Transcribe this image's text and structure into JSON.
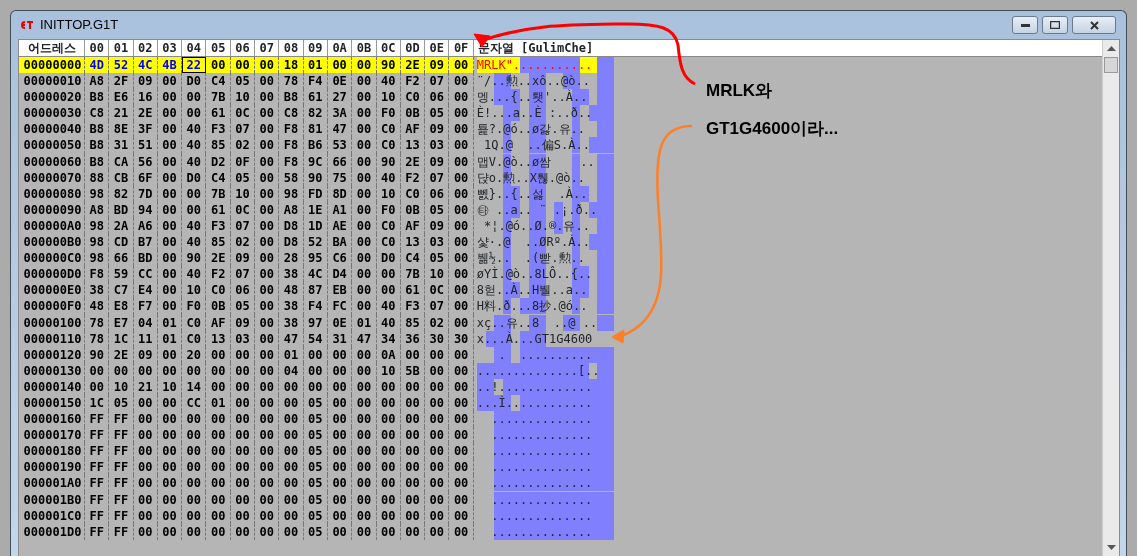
{
  "window": {
    "title": "INITTOP.G1T"
  },
  "header": {
    "address": "어드레스",
    "columns": [
      "00",
      "01",
      "02",
      "03",
      "04",
      "05",
      "06",
      "07",
      "08",
      "09",
      "0A",
      "0B",
      "0C",
      "0D",
      "0E",
      "0F"
    ],
    "text": "문자열 [GulimChe]"
  },
  "rows": [
    {
      "address": "00000000",
      "selected": true,
      "bytes": [
        {
          "v": "4D",
          "found": true
        },
        {
          "v": "52",
          "found": true
        },
        {
          "v": "4C",
          "found": true
        },
        {
          "v": "4B",
          "found": true
        },
        {
          "v": "22",
          "found": true,
          "cursor": true
        },
        "00",
        "00",
        "00",
        "18",
        "01",
        "00",
        "00",
        "90",
        "2E",
        "09",
        "00"
      ],
      "text": "MRLK\"..........."
    },
    {
      "address": "00000010",
      "selected": false,
      "bytes": [
        "A8",
        "2F",
        "09",
        "00",
        "D0",
        "C4",
        "05",
        "00",
        "78",
        "F4",
        "0E",
        "00",
        "40",
        "F2",
        "07",
        "00"
      ],
      "text": "¨/..勲..xô..@ò.."
    },
    {
      "address": "00000020",
      "selected": false,
      "bytes": [
        "B8",
        "E6",
        "16",
        "00",
        "00",
        "7B",
        "10",
        "00",
        "B8",
        "61",
        "27",
        "00",
        "10",
        "C0",
        "06",
        "00"
      ],
      "text": "멩...{..퇫'..À.."
    },
    {
      "address": "00000030",
      "selected": false,
      "bytes": [
        "C8",
        "21",
        "2E",
        "00",
        "00",
        "61",
        "0C",
        "00",
        "C8",
        "82",
        "3A",
        "00",
        "F0",
        "0B",
        "05",
        "00"
      ],
      "text": "È!...a..È :..ð.."
    },
    {
      "address": "00000040",
      "selected": false,
      "bytes": [
        "B8",
        "8E",
        "3F",
        "00",
        "40",
        "F3",
        "07",
        "00",
        "F8",
        "81",
        "47",
        "00",
        "C0",
        "AF",
        "09",
        "00"
      ],
      "text": "툝?.@ó..ø갏.유.."
    },
    {
      "address": "00000050",
      "selected": false,
      "bytes": [
        "B8",
        "31",
        "51",
        "00",
        "40",
        "85",
        "02",
        "00",
        "F8",
        "B6",
        "53",
        "00",
        "C0",
        "13",
        "03",
        "00"
      ],
      "text": " 1Q.@  ..偏S.À.."
    },
    {
      "address": "00000060",
      "selected": false,
      "bytes": [
        "B8",
        "CA",
        "56",
        "00",
        "40",
        "D2",
        "0F",
        "00",
        "F8",
        "9C",
        "66",
        "00",
        "90",
        "2E",
        "09",
        "00"
      ],
      "text": "맵V.@ò..ø쌈    .."
    },
    {
      "address": "00000070",
      "selected": false,
      "bytes": [
        "88",
        "CB",
        "6F",
        "00",
        "D0",
        "C4",
        "05",
        "00",
        "58",
        "90",
        "75",
        "00",
        "40",
        "F2",
        "07",
        "00"
      ],
      "text": "댡o.勲..X퉪.@ò.."
    },
    {
      "address": "00000080",
      "selected": false,
      "bytes": [
        "98",
        "82",
        "7D",
        "00",
        "00",
        "7B",
        "10",
        "00",
        "98",
        "FD",
        "8D",
        "00",
        "10",
        "C0",
        "06",
        "00"
      ],
      "text": "뻸}..{..섫  .À.."
    },
    {
      "address": "00000090",
      "selected": false,
      "bytes": [
        "A8",
        "BD",
        "94",
        "00",
        "00",
        "61",
        "0C",
        "00",
        "A8",
        "1E",
        "A1",
        "00",
        "F0",
        "0B",
        "05",
        "00"
      ],
      "text": "㉹ ..a.. ¨ .¡.ð.."
    },
    {
      "address": "000000A0",
      "selected": false,
      "bytes": [
        "98",
        "2A",
        "A6",
        "00",
        "40",
        "F3",
        "07",
        "00",
        "D8",
        "1D",
        "AE",
        "00",
        "C0",
        "AF",
        "09",
        "00"
      ],
      "text": " *¦.@ó..Ø.®.유.."
    },
    {
      "address": "000000B0",
      "selected": false,
      "bytes": [
        "98",
        "CD",
        "B7",
        "00",
        "40",
        "85",
        "02",
        "00",
        "D8",
        "52",
        "BA",
        "00",
        "C0",
        "13",
        "03",
        "00"
      ],
      "text": "샻·.@  ..ØRº.À.."
    },
    {
      "address": "000000C0",
      "selected": false,
      "bytes": [
        "98",
        "66",
        "BD",
        "00",
        "90",
        "2E",
        "09",
        "00",
        "28",
        "95",
        "C6",
        "00",
        "D0",
        "C4",
        "05",
        "00"
      ],
      "text": "뷂½..  .(빧.勲.."
    },
    {
      "address": "000000D0",
      "selected": false,
      "bytes": [
        "F8",
        "59",
        "CC",
        "00",
        "40",
        "F2",
        "07",
        "00",
        "38",
        "4C",
        "D4",
        "00",
        "00",
        "7B",
        "10",
        "00"
      ],
      "text": "øYÌ.@ò..8LÔ..{.."
    },
    {
      "address": "000000E0",
      "selected": false,
      "bytes": [
        "38",
        "C7",
        "E4",
        "00",
        "10",
        "C0",
        "06",
        "00",
        "48",
        "87",
        "EB",
        "00",
        "00",
        "61",
        "0C",
        "00"
      ],
      "text": "8헏..À..H뷀..a.."
    },
    {
      "address": "000000F0",
      "selected": false,
      "bytes": [
        "48",
        "E8",
        "F7",
        "00",
        "F0",
        "0B",
        "05",
        "00",
        "38",
        "F4",
        "FC",
        "00",
        "40",
        "F3",
        "07",
        "00"
      ],
      "text": "H料.ð...8抄.@ó.."
    },
    {
      "address": "00000100",
      "selected": false,
      "bytes": [
        "78",
        "E7",
        "04",
        "01",
        "C0",
        "AF",
        "09",
        "00",
        "38",
        "97",
        "0E",
        "01",
        "40",
        "85",
        "02",
        "00"
      ],
      "text": "xç..유..8  ..@ .."
    },
    {
      "address": "00000110",
      "selected": false,
      "bytes": [
        "78",
        "1C",
        "11",
        "01",
        "C0",
        "13",
        "03",
        "00",
        "47",
        "54",
        "31",
        "47",
        "34",
        "36",
        "30",
        "30"
      ],
      "text": "x...À...GT1G4600"
    },
    {
      "address": "00000120",
      "selected": false,
      "bytes": [
        "90",
        "2E",
        "09",
        "00",
        "20",
        "00",
        "00",
        "00",
        "01",
        "00",
        "00",
        "00",
        "0A",
        "00",
        "00",
        "00"
      ],
      "text": "   .  .........."
    },
    {
      "address": "00000130",
      "selected": false,
      "bytes": [
        "00",
        "00",
        "00",
        "00",
        "00",
        "00",
        "00",
        "00",
        "04",
        "00",
        "00",
        "00",
        "10",
        "5B",
        "00",
        "00"
      ],
      "text": "..............[.."
    },
    {
      "address": "00000140",
      "selected": false,
      "bytes": [
        "00",
        "10",
        "21",
        "10",
        "14",
        "00",
        "00",
        "00",
        "00",
        "00",
        "00",
        "00",
        "00",
        "00",
        "00",
        "00"
      ],
      "text": "..!............."
    },
    {
      "address": "00000150",
      "selected": false,
      "bytes": [
        "1C",
        "05",
        "00",
        "00",
        "CC",
        "01",
        "00",
        "00",
        "00",
        "05",
        "00",
        "00",
        "00",
        "00",
        "00",
        "00"
      ],
      "text": "...Ì............"
    },
    {
      "address": "00000160",
      "selected": false,
      "bytes": [
        "FF",
        "FF",
        "00",
        "00",
        "00",
        "00",
        "00",
        "00",
        "00",
        "05",
        "00",
        "00",
        "00",
        "00",
        "00",
        "00"
      ],
      "text": "  .............."
    },
    {
      "address": "00000170",
      "selected": false,
      "bytes": [
        "FF",
        "FF",
        "00",
        "00",
        "00",
        "00",
        "00",
        "00",
        "00",
        "05",
        "00",
        "00",
        "00",
        "00",
        "00",
        "00"
      ],
      "text": "  .............."
    },
    {
      "address": "00000180",
      "selected": false,
      "bytes": [
        "FF",
        "FF",
        "00",
        "00",
        "00",
        "00",
        "00",
        "00",
        "00",
        "05",
        "00",
        "00",
        "00",
        "00",
        "00",
        "00"
      ],
      "text": "  .............."
    },
    {
      "address": "00000190",
      "selected": false,
      "bytes": [
        "FF",
        "FF",
        "00",
        "00",
        "00",
        "00",
        "00",
        "00",
        "00",
        "05",
        "00",
        "00",
        "00",
        "00",
        "00",
        "00"
      ],
      "text": "  .............."
    },
    {
      "address": "000001A0",
      "selected": false,
      "bytes": [
        "FF",
        "FF",
        "00",
        "00",
        "00",
        "00",
        "00",
        "00",
        "00",
        "05",
        "00",
        "00",
        "00",
        "00",
        "00",
        "00"
      ],
      "text": "  .............."
    },
    {
      "address": "000001B0",
      "selected": false,
      "bytes": [
        "FF",
        "FF",
        "00",
        "00",
        "00",
        "00",
        "00",
        "00",
        "00",
        "05",
        "00",
        "00",
        "00",
        "00",
        "00",
        "00"
      ],
      "text": "  .............."
    },
    {
      "address": "000001C0",
      "selected": false,
      "bytes": [
        "FF",
        "FF",
        "00",
        "00",
        "00",
        "00",
        "00",
        "00",
        "00",
        "05",
        "00",
        "00",
        "00",
        "00",
        "00",
        "00"
      ],
      "text": "  .............."
    },
    {
      "address": "000001D0",
      "selected": false,
      "bytes": [
        "FF",
        "FF",
        "00",
        "00",
        "00",
        "00",
        "00",
        "00",
        "00",
        "05",
        "00",
        "00",
        "00",
        "00",
        "00",
        "00"
      ],
      "text": "  .............."
    }
  ],
  "annotations": [
    {
      "text": "MRLK와",
      "color": "#ff0000"
    },
    {
      "text": "GT1G4600이라...",
      "color": "#ff7f27"
    }
  ]
}
